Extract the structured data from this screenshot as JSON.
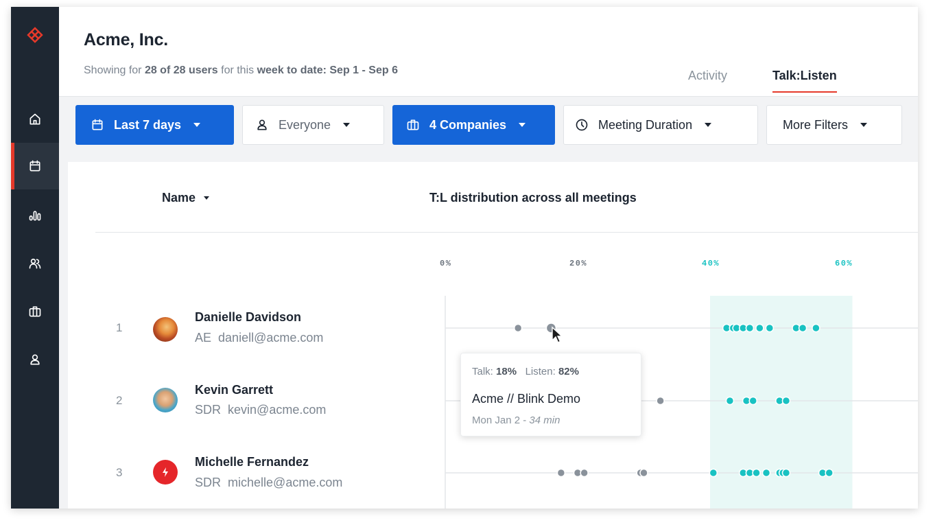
{
  "company": "Acme, Inc.",
  "subtitle": {
    "prefix": "Showing for ",
    "users": "28 of 28 users",
    "middle": " for this ",
    "period": "week to date: Sep 1 - Sep 6"
  },
  "tabs": [
    {
      "label": "Activity",
      "active": false
    },
    {
      "label": "Talk:Listen",
      "active": true
    }
  ],
  "sidebar": {
    "items": [
      {
        "icon": "home-icon",
        "active": false
      },
      {
        "icon": "calendar-icon",
        "active": true
      },
      {
        "icon": "bar-chart-icon",
        "active": false
      },
      {
        "icon": "users-icon",
        "active": false
      },
      {
        "icon": "briefcase-icon",
        "active": false
      },
      {
        "icon": "user-icon",
        "active": false
      }
    ]
  },
  "filters": {
    "date": "Last 7 days",
    "people": "Everyone",
    "companies": "4 Companies",
    "duration": "Meeting Duration",
    "more": "More Filters"
  },
  "table": {
    "name_header": "Name",
    "dist_header": "T:L distribution across all meetings",
    "ticks": [
      "0%",
      "20%",
      "40%",
      "60%"
    ],
    "highlight_range": [
      40,
      61.5
    ]
  },
  "chart_data": {
    "type": "scatter",
    "title": "T:L distribution across all meetings",
    "xlabel": "",
    "ylabel": "",
    "x_ticks": [
      "0%",
      "20%",
      "40%",
      "60%"
    ],
    "xlim": [
      0,
      71
    ],
    "highlight_band": [
      40,
      61.5
    ],
    "series": [
      {
        "name": "Danielle Davidson",
        "talk_pct": [
          11,
          16,
          42.5,
          43.5,
          44,
          45,
          46,
          47.5,
          49,
          53,
          54,
          56
        ]
      },
      {
        "name": "Kevin Garrett",
        "talk_pct": [
          32.5,
          43,
          45.5,
          46.5,
          50.5,
          51.5
        ]
      },
      {
        "name": "Michelle Fernandez",
        "talk_pct": [
          17.5,
          20,
          21,
          29.5,
          30,
          40.5,
          45,
          46,
          47,
          48.5,
          50.5,
          51,
          51.5,
          57,
          58
        ]
      }
    ]
  },
  "people": [
    {
      "rank": "1",
      "name": "Danielle Davidson",
      "role": "AE",
      "email": "daniell@acme.com"
    },
    {
      "rank": "2",
      "name": "Kevin Garrett",
      "role": "SDR",
      "email": "kevin@acme.com"
    },
    {
      "rank": "3",
      "name": "Michelle Fernandez",
      "role": "SDR",
      "email": "michelle@acme.com"
    }
  ],
  "tooltip": {
    "talk_label": "Talk:",
    "talk_value": "18%",
    "listen_label": "Listen:",
    "listen_value": "82%",
    "meeting": "Acme // Blink Demo",
    "date": "Mon Jan 2",
    "separator": "-",
    "duration": "34 min"
  },
  "colors": {
    "primary": "#1565d8",
    "accent": "#e5392a",
    "sidebar": "#1e2732",
    "dot_in_range": "#19c2c2",
    "dot_out_range": "#8a929b",
    "band": "#e8f8f6"
  }
}
